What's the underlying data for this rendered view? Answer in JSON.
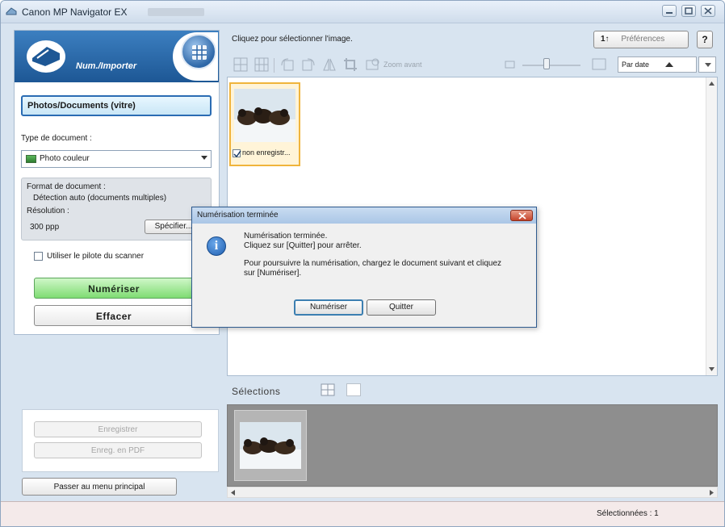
{
  "window": {
    "title": "Canon MP Navigator EX"
  },
  "left": {
    "header_title": "Num./Importer",
    "mode": "Photos/Documents (vitre)",
    "doc_type_label": "Type de document :",
    "doc_type_value": "Photo couleur",
    "doc_format_label": "Format de document :",
    "doc_format_value": "Détection auto (documents multiples)",
    "resolution_label": "Résolution :",
    "resolution_value": "300 ppp",
    "specify_label": "Spécifier...",
    "use_driver_label": "Utiliser le pilote du scanner",
    "scan_label": "Numériser",
    "clear_label": "Effacer",
    "save_label": "Enregistrer",
    "save_pdf_label": "Enreg. en PDF",
    "main_menu_label": "Passer au menu principal"
  },
  "right": {
    "instruction": "Cliquez pour sélectionner l'image.",
    "preferences_label": "Préférences",
    "preferences_icon": "1↑",
    "help_label": "?",
    "zoom_label": "Zoom avant",
    "sort_label": "Par date",
    "thumbnail_caption": "non enregistr...",
    "selections_label": "Sélections"
  },
  "status": {
    "selected": "Sélectionnées : 1"
  },
  "dialog": {
    "title": "Numérisation terminée",
    "line1": "Numérisation terminée.",
    "line2": "Cliquez sur [Quitter] pour arrêter.",
    "line3": "Pour poursuivre la numérisation, chargez le document suivant et cliquez",
    "line4": "sur [Numériser].",
    "scan_btn": "Numériser",
    "quit_btn": "Quitter"
  },
  "colors": {
    "header_blue": "#1d5795",
    "scan_green": "#7fdc73",
    "thumb_border": "#f0b43c",
    "status_bg": "#f4eaea"
  }
}
